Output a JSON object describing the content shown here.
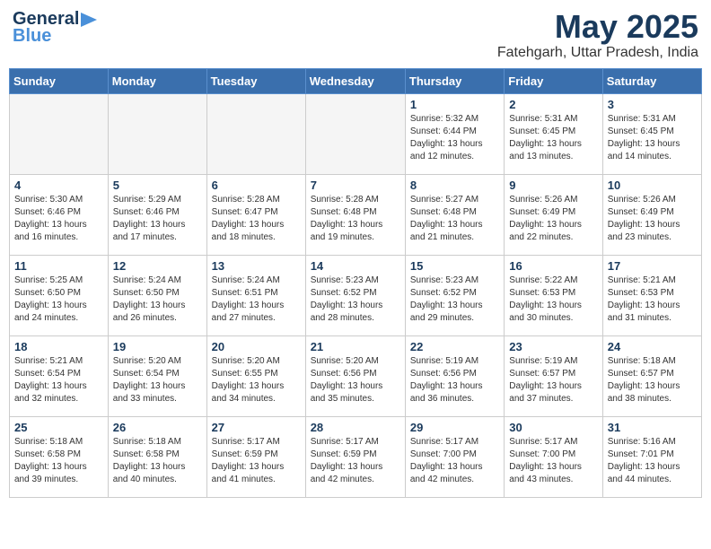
{
  "header": {
    "logo_general": "General",
    "logo_blue": "Blue",
    "month_year": "May 2025",
    "location": "Fatehgarh, Uttar Pradesh, India"
  },
  "days_of_week": [
    "Sunday",
    "Monday",
    "Tuesday",
    "Wednesday",
    "Thursday",
    "Friday",
    "Saturday"
  ],
  "weeks": [
    [
      {
        "day": "",
        "info": "",
        "empty": true
      },
      {
        "day": "",
        "info": "",
        "empty": true
      },
      {
        "day": "",
        "info": "",
        "empty": true
      },
      {
        "day": "",
        "info": "",
        "empty": true
      },
      {
        "day": "1",
        "info": "Sunrise: 5:32 AM\nSunset: 6:44 PM\nDaylight: 13 hours\nand 12 minutes."
      },
      {
        "day": "2",
        "info": "Sunrise: 5:31 AM\nSunset: 6:45 PM\nDaylight: 13 hours\nand 13 minutes."
      },
      {
        "day": "3",
        "info": "Sunrise: 5:31 AM\nSunset: 6:45 PM\nDaylight: 13 hours\nand 14 minutes."
      }
    ],
    [
      {
        "day": "4",
        "info": "Sunrise: 5:30 AM\nSunset: 6:46 PM\nDaylight: 13 hours\nand 16 minutes."
      },
      {
        "day": "5",
        "info": "Sunrise: 5:29 AM\nSunset: 6:46 PM\nDaylight: 13 hours\nand 17 minutes."
      },
      {
        "day": "6",
        "info": "Sunrise: 5:28 AM\nSunset: 6:47 PM\nDaylight: 13 hours\nand 18 minutes."
      },
      {
        "day": "7",
        "info": "Sunrise: 5:28 AM\nSunset: 6:48 PM\nDaylight: 13 hours\nand 19 minutes."
      },
      {
        "day": "8",
        "info": "Sunrise: 5:27 AM\nSunset: 6:48 PM\nDaylight: 13 hours\nand 21 minutes."
      },
      {
        "day": "9",
        "info": "Sunrise: 5:26 AM\nSunset: 6:49 PM\nDaylight: 13 hours\nand 22 minutes."
      },
      {
        "day": "10",
        "info": "Sunrise: 5:26 AM\nSunset: 6:49 PM\nDaylight: 13 hours\nand 23 minutes."
      }
    ],
    [
      {
        "day": "11",
        "info": "Sunrise: 5:25 AM\nSunset: 6:50 PM\nDaylight: 13 hours\nand 24 minutes."
      },
      {
        "day": "12",
        "info": "Sunrise: 5:24 AM\nSunset: 6:50 PM\nDaylight: 13 hours\nand 26 minutes."
      },
      {
        "day": "13",
        "info": "Sunrise: 5:24 AM\nSunset: 6:51 PM\nDaylight: 13 hours\nand 27 minutes."
      },
      {
        "day": "14",
        "info": "Sunrise: 5:23 AM\nSunset: 6:52 PM\nDaylight: 13 hours\nand 28 minutes."
      },
      {
        "day": "15",
        "info": "Sunrise: 5:23 AM\nSunset: 6:52 PM\nDaylight: 13 hours\nand 29 minutes."
      },
      {
        "day": "16",
        "info": "Sunrise: 5:22 AM\nSunset: 6:53 PM\nDaylight: 13 hours\nand 30 minutes."
      },
      {
        "day": "17",
        "info": "Sunrise: 5:21 AM\nSunset: 6:53 PM\nDaylight: 13 hours\nand 31 minutes."
      }
    ],
    [
      {
        "day": "18",
        "info": "Sunrise: 5:21 AM\nSunset: 6:54 PM\nDaylight: 13 hours\nand 32 minutes."
      },
      {
        "day": "19",
        "info": "Sunrise: 5:20 AM\nSunset: 6:54 PM\nDaylight: 13 hours\nand 33 minutes."
      },
      {
        "day": "20",
        "info": "Sunrise: 5:20 AM\nSunset: 6:55 PM\nDaylight: 13 hours\nand 34 minutes."
      },
      {
        "day": "21",
        "info": "Sunrise: 5:20 AM\nSunset: 6:56 PM\nDaylight: 13 hours\nand 35 minutes."
      },
      {
        "day": "22",
        "info": "Sunrise: 5:19 AM\nSunset: 6:56 PM\nDaylight: 13 hours\nand 36 minutes."
      },
      {
        "day": "23",
        "info": "Sunrise: 5:19 AM\nSunset: 6:57 PM\nDaylight: 13 hours\nand 37 minutes."
      },
      {
        "day": "24",
        "info": "Sunrise: 5:18 AM\nSunset: 6:57 PM\nDaylight: 13 hours\nand 38 minutes."
      }
    ],
    [
      {
        "day": "25",
        "info": "Sunrise: 5:18 AM\nSunset: 6:58 PM\nDaylight: 13 hours\nand 39 minutes."
      },
      {
        "day": "26",
        "info": "Sunrise: 5:18 AM\nSunset: 6:58 PM\nDaylight: 13 hours\nand 40 minutes."
      },
      {
        "day": "27",
        "info": "Sunrise: 5:17 AM\nSunset: 6:59 PM\nDaylight: 13 hours\nand 41 minutes."
      },
      {
        "day": "28",
        "info": "Sunrise: 5:17 AM\nSunset: 6:59 PM\nDaylight: 13 hours\nand 42 minutes."
      },
      {
        "day": "29",
        "info": "Sunrise: 5:17 AM\nSunset: 7:00 PM\nDaylight: 13 hours\nand 42 minutes."
      },
      {
        "day": "30",
        "info": "Sunrise: 5:17 AM\nSunset: 7:00 PM\nDaylight: 13 hours\nand 43 minutes."
      },
      {
        "day": "31",
        "info": "Sunrise: 5:16 AM\nSunset: 7:01 PM\nDaylight: 13 hours\nand 44 minutes."
      }
    ]
  ]
}
